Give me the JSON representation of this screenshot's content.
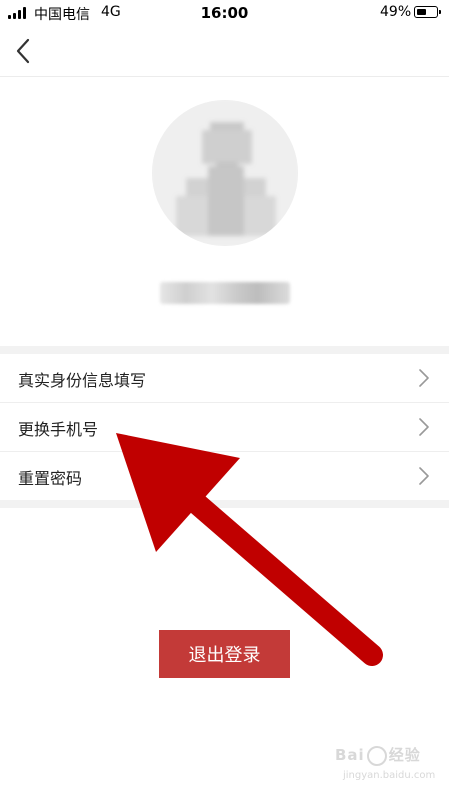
{
  "status_bar": {
    "carrier": "中国电信",
    "network": "4G",
    "time": "16:00",
    "battery_percent": "49%",
    "battery_level": 0.49
  },
  "nav": {
    "back_icon": "chevron-left-icon"
  },
  "profile": {
    "avatar_icon": "avatar-placeholder (pixelated)",
    "username_obscured": true
  },
  "menu": {
    "items": [
      {
        "label": "真实身份信息填写",
        "icon": "chevron-right-icon"
      },
      {
        "label": "更换手机号",
        "icon": "chevron-right-icon"
      },
      {
        "label": "重置密码",
        "icon": "chevron-right-icon"
      }
    ]
  },
  "logout": {
    "label": "退出登录",
    "color": "#c33a38"
  },
  "annotation": {
    "arrow_color": "#c00000",
    "points_to": "更换手机号"
  },
  "watermark": {
    "brand": "Bai",
    "suffix": "经验",
    "sub": "jingyan.baidu.com"
  }
}
